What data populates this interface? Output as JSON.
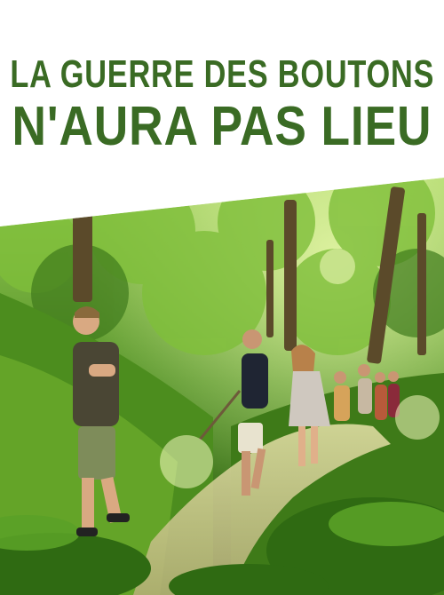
{
  "poster": {
    "title_line1": "LA GUERRE DES BOUTONS",
    "title_line2": "N'AURA PAS LIEU",
    "title_color": "#3a6b24",
    "background_color": "#ffffff"
  },
  "photo": {
    "subject": "children-walking-in-forest"
  }
}
